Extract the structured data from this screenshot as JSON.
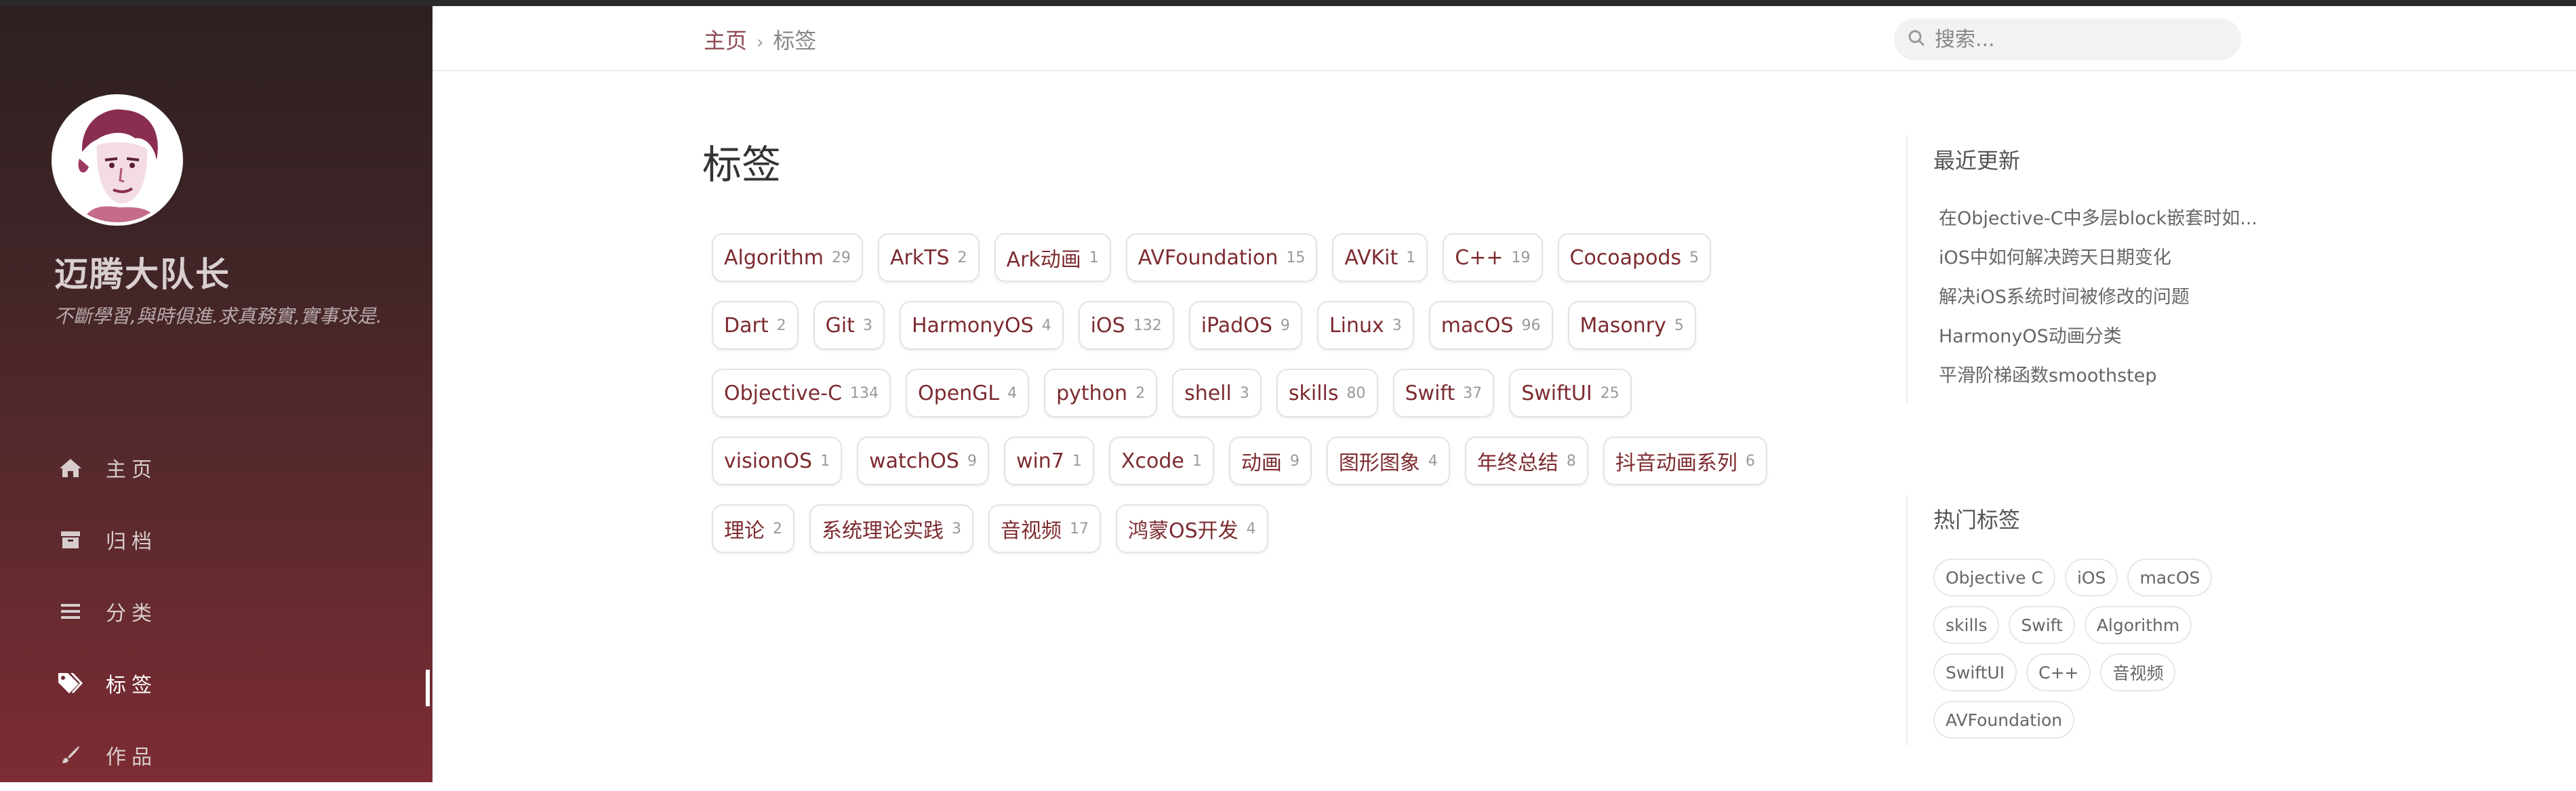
{
  "site": {
    "title": "迈腾大队长",
    "subtitle": "不斷學習,與時俱進.求真務實,實事求是."
  },
  "nav": [
    {
      "label": "主页",
      "icon": "home-icon"
    },
    {
      "label": "归档",
      "icon": "archive-icon"
    },
    {
      "label": "分类",
      "icon": "list-icon"
    },
    {
      "label": "标签",
      "icon": "tags-icon",
      "active": true
    },
    {
      "label": "作品",
      "icon": "brush-icon"
    }
  ],
  "header": {
    "breadcrumb": {
      "home": "主页",
      "separator": "›",
      "current": "标签"
    },
    "search_placeholder": "搜索..."
  },
  "main": {
    "title": "标签",
    "tags": [
      {
        "name": "Algorithm",
        "count": "29"
      },
      {
        "name": "ArkTS",
        "count": "2"
      },
      {
        "name": "Ark动画",
        "count": "1"
      },
      {
        "name": "AVFoundation",
        "count": "15"
      },
      {
        "name": "AVKit",
        "count": "1"
      },
      {
        "name": "C++",
        "count": "19"
      },
      {
        "name": "Cocoapods",
        "count": "5"
      },
      {
        "name": "Dart",
        "count": "2"
      },
      {
        "name": "Git",
        "count": "3"
      },
      {
        "name": "HarmonyOS",
        "count": "4"
      },
      {
        "name": "iOS",
        "count": "132"
      },
      {
        "name": "iPadOS",
        "count": "9"
      },
      {
        "name": "Linux",
        "count": "3"
      },
      {
        "name": "macOS",
        "count": "96"
      },
      {
        "name": "Masonry",
        "count": "5"
      },
      {
        "name": "Objective-C",
        "count": "134"
      },
      {
        "name": "OpenGL",
        "count": "4"
      },
      {
        "name": "python",
        "count": "2"
      },
      {
        "name": "shell",
        "count": "3"
      },
      {
        "name": "skills",
        "count": "80"
      },
      {
        "name": "Swift",
        "count": "37"
      },
      {
        "name": "SwiftUI",
        "count": "25"
      },
      {
        "name": "visionOS",
        "count": "1"
      },
      {
        "name": "watchOS",
        "count": "9"
      },
      {
        "name": "win7",
        "count": "1"
      },
      {
        "name": "Xcode",
        "count": "1"
      },
      {
        "name": "动画",
        "count": "9"
      },
      {
        "name": "图形图象",
        "count": "4"
      },
      {
        "name": "年终总结",
        "count": "8"
      },
      {
        "name": "抖音动画系列",
        "count": "6"
      },
      {
        "name": "理论",
        "count": "2"
      },
      {
        "name": "系统理论实践",
        "count": "3"
      },
      {
        "name": "音视频",
        "count": "17"
      },
      {
        "name": "鸿蒙OS开发",
        "count": "4"
      }
    ]
  },
  "sidebar_right": {
    "recent_title": "最近更新",
    "recent": [
      "在Objective-C中多层block嵌套时如...",
      "iOS中如何解决跨天日期变化",
      "解决iOS系统时间被修改的问题",
      "HarmonyOS动画分类",
      "平滑阶梯函数smoothstep"
    ],
    "hot_title": "热门标签",
    "hot_tags": [
      "Objective C",
      "iOS",
      "macOS",
      "skills",
      "Swift",
      "Algorithm",
      "SwiftUI",
      "C++",
      "音视频",
      "AVFoundation"
    ]
  },
  "colors": {
    "accent": "#7d2b30",
    "sidebar_top": "#2d2021",
    "sidebar_bottom": "#7d2c33"
  }
}
